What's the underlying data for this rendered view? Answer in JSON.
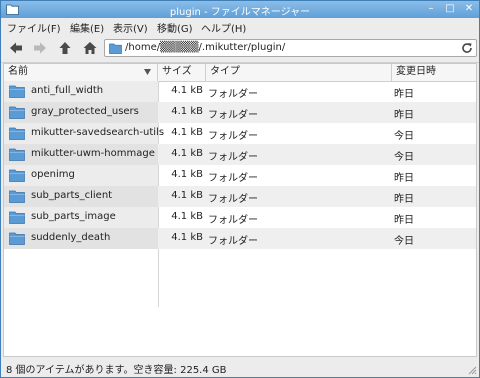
{
  "window": {
    "title": "plugin - ファイルマネージャー",
    "controls": {
      "minimize": "–",
      "maximize": "□",
      "close": "✕"
    }
  },
  "menu": [
    "ファイル(F)",
    "編集(E)",
    "表示(V)",
    "移動(G)",
    "ヘルプ(H)"
  ],
  "toolbar": {
    "back_icon": "arrow-left-icon",
    "forward_icon": "arrow-right-icon",
    "up_icon": "arrow-up-icon",
    "home_icon": "home-icon",
    "path": "/home/▒▒▒▒▒/.mikutter/plugin/",
    "reload_icon": "reload-icon"
  },
  "columns": {
    "name": "名前",
    "size": "サイズ",
    "type": "タイプ",
    "modified": "変更日時"
  },
  "files": [
    {
      "name": "anti_full_width",
      "size": "4.1 kB",
      "type": "フォルダー",
      "modified": "昨日"
    },
    {
      "name": "gray_protected_users",
      "size": "4.1 kB",
      "type": "フォルダー",
      "modified": "昨日"
    },
    {
      "name": "mikutter-savedsearch-utils",
      "size": "4.1 kB",
      "type": "フォルダー",
      "modified": "今日"
    },
    {
      "name": "mikutter-uwm-hommage",
      "size": "4.1 kB",
      "type": "フォルダー",
      "modified": "今日"
    },
    {
      "name": "openimg",
      "size": "4.1 kB",
      "type": "フォルダー",
      "modified": "昨日"
    },
    {
      "name": "sub_parts_client",
      "size": "4.1 kB",
      "type": "フォルダー",
      "modified": "昨日"
    },
    {
      "name": "sub_parts_image",
      "size": "4.1 kB",
      "type": "フォルダー",
      "modified": "昨日"
    },
    {
      "name": "suddenly_death",
      "size": "4.1 kB",
      "type": "フォルダー",
      "modified": "今日"
    }
  ],
  "status": "8 個のアイテムがあります。空き容量: 225.4 GB",
  "colors": {
    "titlebar": "#5f9fd8",
    "folder": "#5b9bd5",
    "toolbar_icon": "#4a4a4a"
  }
}
